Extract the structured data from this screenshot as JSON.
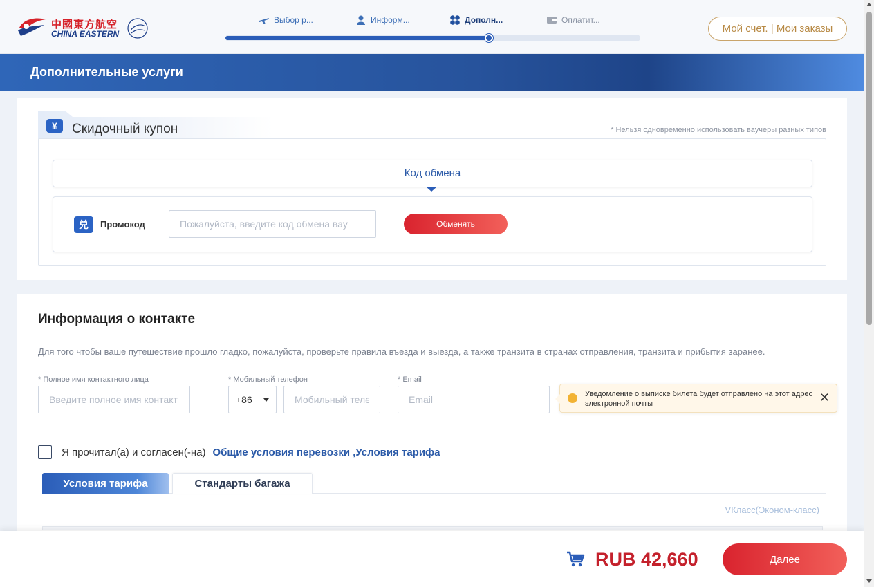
{
  "header": {
    "logo_cn": "中國東方航空",
    "logo_en": "CHINA EASTERN",
    "steps": [
      {
        "label": "Выбор р...",
        "icon": "plane-icon",
        "state": "done"
      },
      {
        "label": "Информ...",
        "icon": "person-icon",
        "state": "done"
      },
      {
        "label": "Дополн...",
        "icon": "clover-icon",
        "state": "active"
      },
      {
        "label": "Оплатит...",
        "icon": "wallet-icon",
        "state": "pending"
      }
    ],
    "progress": 0.635,
    "account_label": "Мой счет. | Мои заказы"
  },
  "banner": {
    "title": "Дополнительные услуги"
  },
  "coupon": {
    "title": "Скидочный купон",
    "icon": "yen-icon",
    "note": "* Нельзя одновременно использовать ваучеры разных типов",
    "code_tab": "Код обмена",
    "promo_label": "Промокод",
    "promo_placeholder": "Пожалуйста, введите код обмена вау",
    "promo_value": "",
    "exchange_button": "Обменять"
  },
  "contact": {
    "title": "Информация о контакте",
    "description": "Для того чтобы ваше путешествие прошло гладко, пожалуйста, проверьте правила въезда и выезда, а также транзита в странах отправления, транзита и прибытия заранее.",
    "name_label": "* Полное имя контактного лица",
    "name_placeholder": "Введите полное имя контакт",
    "phone_label": "* Мобильный телефон",
    "country_code": "+86",
    "phone_placeholder": "Мобильный теле",
    "email_label": "* Email",
    "email_placeholder": "Email",
    "email_tooltip": "Уведомление о выписке билета будет отправлено на этот адрес электронной почты",
    "tooltip_close": "✕",
    "agree_text": "Я прочитал(а) и согласен(-на)",
    "agree_link": "Общие условия перевозки ,Условия тарифа",
    "agree_checked": false,
    "tabs": [
      "Условия тарифа",
      "Стандарты багажа"
    ],
    "active_tab": 0,
    "class_label": "VКласс(Эконом-класс)"
  },
  "footer": {
    "price": "RUB 42,660",
    "next_button": "Далее"
  },
  "colors": {
    "brand_blue": "#2b5db8",
    "brand_red": "#d9232e",
    "gold": "#b88a45"
  }
}
